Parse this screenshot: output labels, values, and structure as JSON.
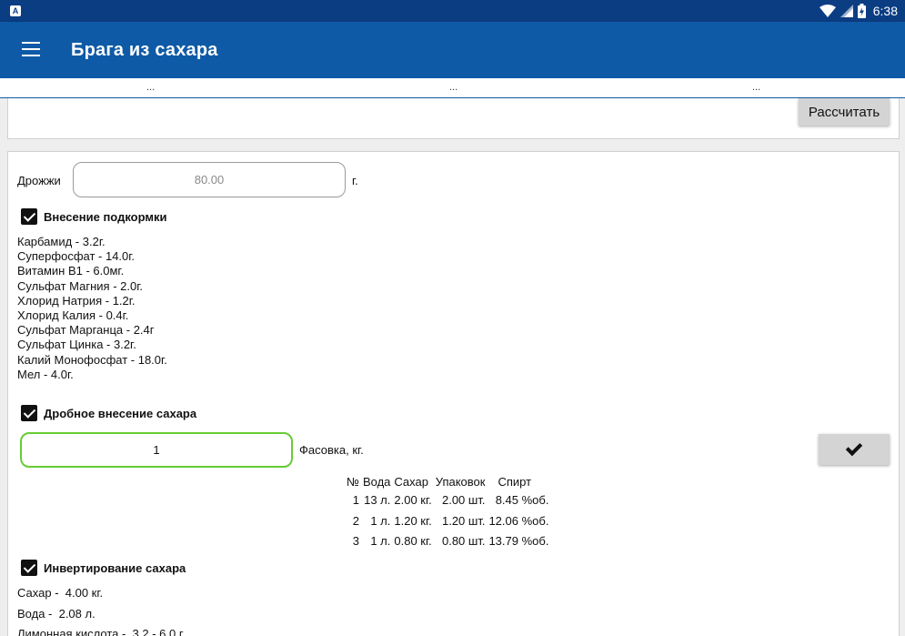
{
  "status_bar": {
    "time": "6:38",
    "icons": [
      "app-a-icon",
      "wifi-icon",
      "signal-icon",
      "battery-charging-icon"
    ]
  },
  "app_bar": {
    "title": "Брага из сахара"
  },
  "tabs": [
    "...",
    "...",
    "..."
  ],
  "calc_button": "Рассчитать",
  "yeast": {
    "label": "Дрожжи",
    "value": "80.00",
    "unit": "г."
  },
  "feeding": {
    "label": "Внесение подкормки",
    "checked": true,
    "items": [
      "Карбамид - 3.2г.",
      "Суперфосфат - 14.0г.",
      "Витамин В1 - 6.0мг.",
      "Сульфат Магния - 2.0г.",
      "Хлорид Натрия - 1.2г.",
      "Хлорид Калия - 0.4г.",
      "Сульфат Марганца - 2.4г",
      "Сульфат Цинка - 3.2г.",
      "Калий Монофосфат - 18.0г.",
      "Мел - 4.0г."
    ]
  },
  "fractional": {
    "label": "Дробное внесение сахара",
    "checked": true,
    "pack_value": "1",
    "pack_label": "Фасовка, кг.",
    "table_headers": [
      "№",
      "Вода",
      "Сахар",
      "Упаковок",
      "Спирт"
    ],
    "rows": [
      [
        "1",
        "13 л.",
        "2.00 кг.",
        "2.00 шт.",
        "8.45 %об."
      ],
      [
        "2",
        "1 л.",
        "1.20 кг.",
        "1.20 шт.",
        "12.06 %об."
      ],
      [
        "3",
        "1 л.",
        "0.80 кг.",
        "0.80 шт.",
        "13.79 %об."
      ]
    ]
  },
  "inversion": {
    "label": "Инвертирование сахара",
    "checked": true,
    "lines": [
      "Сахар -  4.00 кг.",
      "Вода -  2.08 л.",
      "Лимонная кислота -  3.2 - 6.0 г."
    ]
  }
}
